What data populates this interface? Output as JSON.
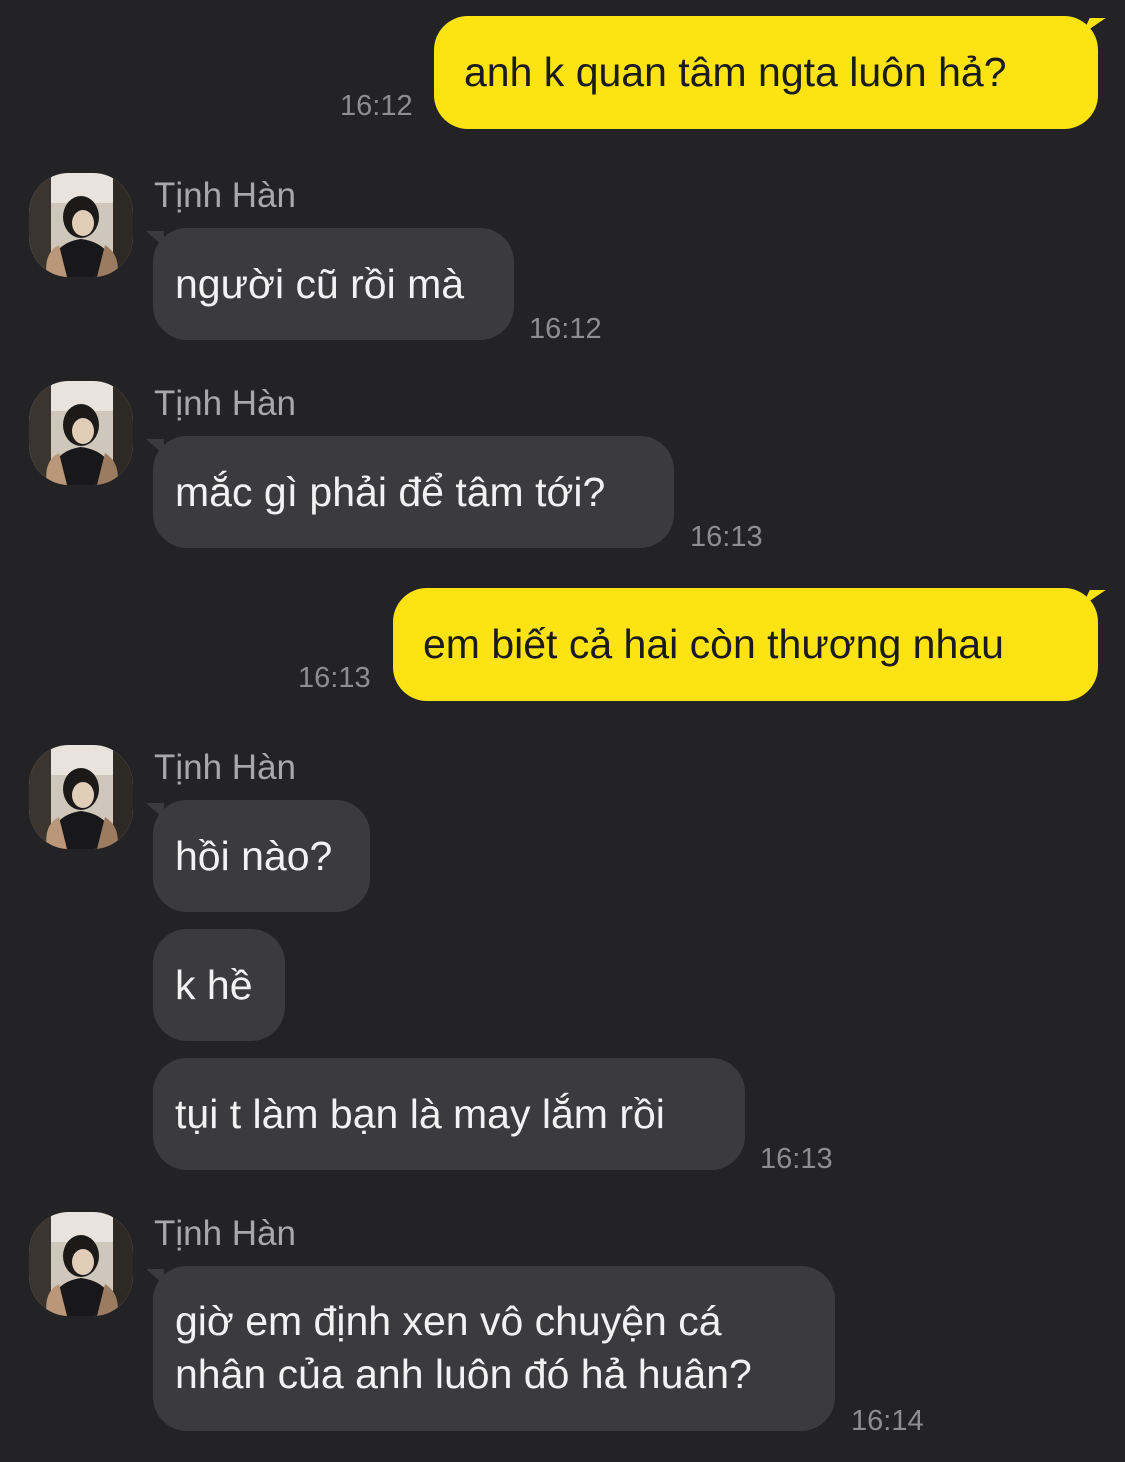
{
  "contact_name": "Tịnh Hàn",
  "messages": [
    {
      "direction": "out",
      "text": "anh k quan tâm ngta luôn hả?",
      "time": "16:12"
    },
    {
      "direction": "in",
      "sender": "Tịnh Hàn",
      "text": "người cũ rồi mà",
      "time": "16:12"
    },
    {
      "direction": "in",
      "sender": "Tịnh Hàn",
      "text": "mắc gì phải để tâm tới?",
      "time": "16:13"
    },
    {
      "direction": "out",
      "text": "em biết cả hai còn thương nhau",
      "time": "16:13"
    },
    {
      "direction": "in",
      "sender": "Tịnh Hàn",
      "text": "hồi nào?",
      "time": ""
    },
    {
      "direction": "in",
      "text": "k hề",
      "time": ""
    },
    {
      "direction": "in",
      "text": "tụi t làm bạn là may lắm rồi",
      "time": "16:13"
    },
    {
      "direction": "in",
      "sender": "Tịnh Hàn",
      "text": "giờ em định xen vô chuyện cá nhân của anh luôn đó hả huân?",
      "time": "16:14"
    }
  ],
  "colors": {
    "background": "#232325",
    "outgoing_bubble": "#fde311",
    "incoming_bubble": "#3b3b3d",
    "timestamp": "#8e8e90"
  }
}
